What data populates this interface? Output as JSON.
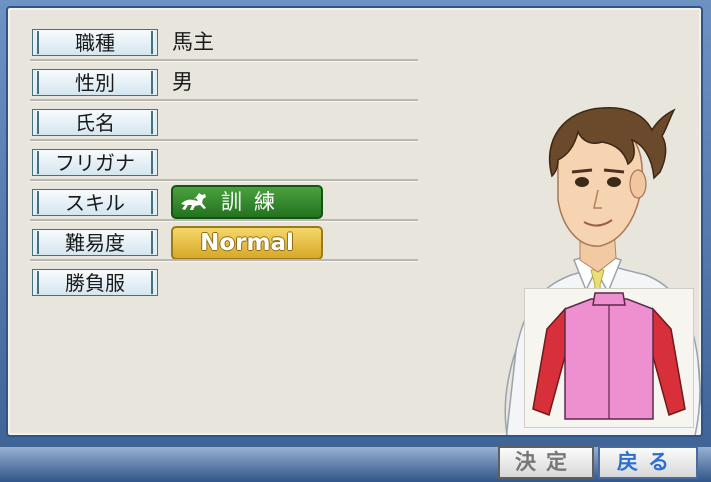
{
  "fields": [
    {
      "label": "職種",
      "value": "馬主"
    },
    {
      "label": "性別",
      "value": "男"
    },
    {
      "label": "氏名",
      "value": ""
    },
    {
      "label": "フリガナ",
      "value": ""
    },
    {
      "label": "スキル",
      "value": ""
    },
    {
      "label": "難易度",
      "value": ""
    },
    {
      "label": "勝負服",
      "value": ""
    }
  ],
  "skill": {
    "label": "訓練",
    "icon": "running-horse-icon",
    "color": "#2f8a2a"
  },
  "difficulty": {
    "label": "Normal",
    "color": "#e6bf3e"
  },
  "silks": {
    "body_color": "#ee8fcf",
    "sleeve_color": "#d8303a"
  },
  "buttons": {
    "decide": "決定",
    "back": "戻る"
  },
  "colors": {
    "panel": "#e8e5dc",
    "frame": "#3f6496",
    "back_text": "#2c6fd0"
  }
}
